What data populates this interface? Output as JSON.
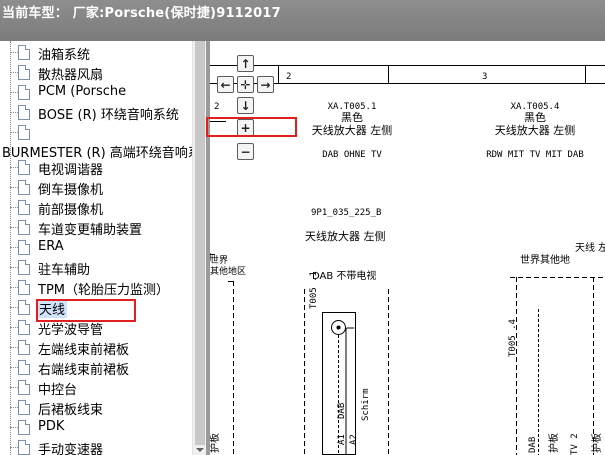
{
  "window": {
    "title": "当前车型：  厂家:Porsche(保时捷)9112017"
  },
  "tree": {
    "items_top": [
      {
        "label": "油箱系统"
      },
      {
        "label": "散热器风扇"
      },
      {
        "label": "PCM (Porsche"
      },
      {
        "label": "BOSE (R) 环绕音响系统"
      },
      {
        "label": ""
      }
    ],
    "burmester_label": "BURMESTER (R) 高端环绕音响系",
    "items_bottom": [
      {
        "label": "电视调谐器"
      },
      {
        "label": "倒车摄像机"
      },
      {
        "label": "前部摄像机"
      },
      {
        "label": "车道变更辅助装置"
      },
      {
        "label": "ERA"
      },
      {
        "label": "驻车辅助"
      },
      {
        "label": "TPM（轮胎压力监测）"
      },
      {
        "label": "天线",
        "selected": true
      },
      {
        "label": "光学波导管"
      },
      {
        "label": "左端线束前裙板"
      },
      {
        "label": "右端线束前裙板"
      },
      {
        "label": "中控台"
      },
      {
        "label": "后裙板线束"
      },
      {
        "label": "PDK"
      },
      {
        "label": "手动变速器"
      }
    ]
  },
  "viewer": {
    "nav": {
      "up": "↑",
      "left": "←",
      "center": "✛",
      "right": "→",
      "down": "↓",
      "zoom_in": "+",
      "zoom_out": "−"
    },
    "diagram": {
      "col_2": "2",
      "col_3": "3",
      "row_2": "2",
      "xa1_code": "XA.T005.1",
      "xa1_color": "黑色",
      "xa1_name": "天线放大器 左侧",
      "xa1_note": "DAB OHNE TV",
      "xa4_code": "XA.T005.4",
      "xa4_color": "黑色",
      "xa4_name": "天线放大器 左侧",
      "xa4_note": "RDW MIT TV MIT DAB",
      "part_code": "9P1_035_225_B",
      "part_name": "天线放大器 左侧",
      "right_name_1": "天线 左",
      "right_name_2": "世界其他地",
      "region_1": "世界",
      "region_2": "其他地区",
      "dab_label": "DAB 不带电视",
      "t005_1": "T005 .1",
      "t005_4": "T005 .4",
      "dab_v": "DAB",
      "schirm": "Schirm",
      "a1": "A1",
      "a2": "A2",
      "hubban": "护板",
      "tv2": "TV 2"
    }
  },
  "colors": {
    "titlebar": "#808080",
    "highlight": "#e02020",
    "selection": "#cfe3fb"
  }
}
